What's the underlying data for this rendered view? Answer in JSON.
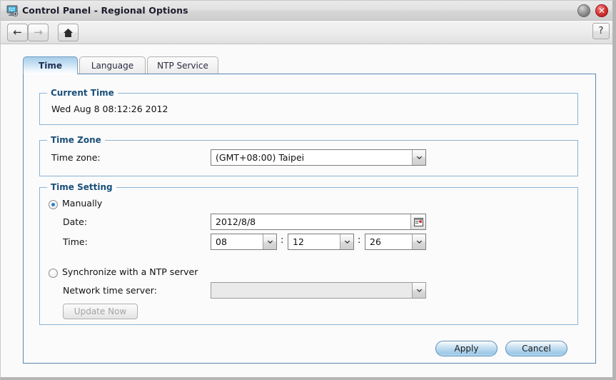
{
  "window": {
    "title": "Control Panel - Regional Options",
    "icon": "control-panel-icon",
    "minimize_label": "",
    "close_label": "✕"
  },
  "toolbar": {
    "back_icon": "←",
    "forward_icon": "→",
    "home_icon": "⌂",
    "help_label": "?"
  },
  "tabs": [
    {
      "label": "Time",
      "active": true
    },
    {
      "label": "Language",
      "active": false
    },
    {
      "label": "NTP Service",
      "active": false
    }
  ],
  "current_time": {
    "legend": "Current Time",
    "value": "Wed Aug 8 08:12:26 2012"
  },
  "time_zone": {
    "legend": "Time Zone",
    "label": "Time zone:",
    "value": "(GMT+08:00) Taipei",
    "arrow": "▼"
  },
  "time_setting": {
    "legend": "Time Setting",
    "manual": {
      "label": "Manually",
      "selected": true,
      "date_label": "Date:",
      "date_value": "2012/8/8",
      "calendar_icon": "calendar-icon",
      "time_label": "Time:",
      "hour": "08",
      "minute": "12",
      "second": "26",
      "separator": ":"
    },
    "ntp": {
      "label": "Synchronize with a NTP server",
      "selected": false,
      "server_label": "Network time server:",
      "server_value": "",
      "update_button": "Update Now"
    }
  },
  "footer": {
    "apply_label": "Apply",
    "cancel_label": "Cancel"
  },
  "colors": {
    "accent_blue": "#1a4f7a",
    "panel_border": "#5a87ad",
    "fieldset_border": "#8cb4d6",
    "radio_dot": "#2a7fc9",
    "close_red": "#d93c3c"
  }
}
